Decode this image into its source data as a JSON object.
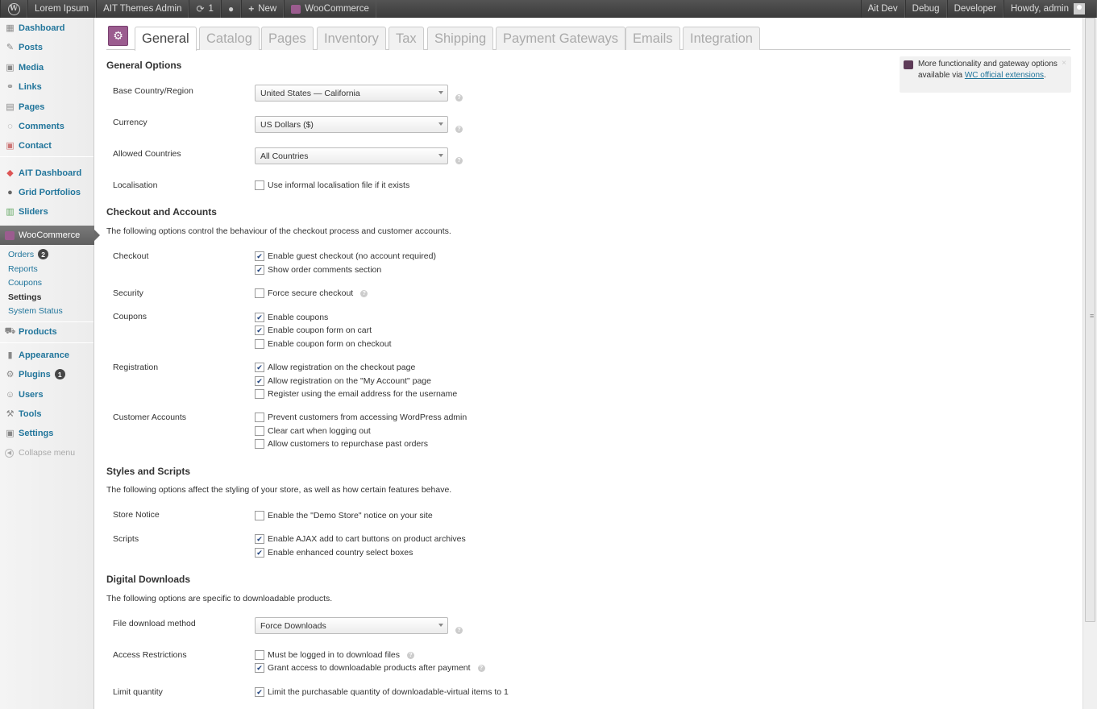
{
  "admin_bar": {
    "wp_logo": "W",
    "site_name": "Lorem Ipsum",
    "themes_admin": "AIT Themes Admin",
    "updates_count": "1",
    "new_label": "New",
    "woocommerce": "WooCommerce",
    "right": [
      "Ait Dev",
      "Debug",
      "Developer"
    ],
    "howdy": "Howdy, admin"
  },
  "sidebar": {
    "items": [
      {
        "label": "Dashboard",
        "icon": "dashboard-icon"
      },
      {
        "label": "Posts",
        "icon": "posts-icon"
      },
      {
        "label": "Media",
        "icon": "media-icon"
      },
      {
        "label": "Links",
        "icon": "links-icon"
      },
      {
        "label": "Pages",
        "icon": "pages-icon"
      },
      {
        "label": "Comments",
        "icon": "comments-icon"
      },
      {
        "label": "Contact",
        "icon": "contact-icon"
      },
      {
        "label": "AIT Dashboard",
        "icon": "ait-dashboard-icon"
      },
      {
        "label": "Grid Portfolios",
        "icon": "grid-portfolios-icon"
      },
      {
        "label": "Sliders",
        "icon": "sliders-icon"
      },
      {
        "label": "WooCommerce",
        "icon": "woocommerce-icon"
      },
      {
        "label": "Products",
        "icon": "products-icon"
      },
      {
        "label": "Appearance",
        "icon": "appearance-icon"
      },
      {
        "label": "Plugins",
        "icon": "plugins-icon",
        "badge": "1"
      },
      {
        "label": "Users",
        "icon": "users-icon"
      },
      {
        "label": "Tools",
        "icon": "tools-icon"
      },
      {
        "label": "Settings",
        "icon": "settings-icon"
      }
    ],
    "woo_submenu": [
      {
        "label": "Orders",
        "badge": "2"
      },
      {
        "label": "Reports"
      },
      {
        "label": "Coupons"
      },
      {
        "label": "Settings",
        "current": true
      },
      {
        "label": "System Status"
      }
    ],
    "collapse_label": "Collapse menu"
  },
  "tabs": [
    "General",
    "Catalog",
    "Pages",
    "Inventory",
    "Tax",
    "Shipping",
    "Payment Gateways",
    "Emails",
    "Integration"
  ],
  "active_tab": "General",
  "notice": {
    "text_before": "More functionality and gateway options available via ",
    "link": "WC official extensions",
    "text_after": ".",
    "close": "×"
  },
  "general_options": {
    "title": "General Options",
    "base_country_label": "Base Country/Region",
    "base_country_value": "United States — California",
    "currency_label": "Currency",
    "currency_value": "US Dollars ($)",
    "allowed_countries_label": "Allowed Countries",
    "allowed_countries_value": "All Countries",
    "localisation_label": "Localisation",
    "localisation_cb": "Use informal localisation file if it exists"
  },
  "checkout_accounts": {
    "title": "Checkout and Accounts",
    "desc": "The following options control the behaviour of the checkout process and customer accounts.",
    "checkout_label": "Checkout",
    "guest_checkout": "Enable guest checkout (no account required)",
    "order_comments": "Show order comments section",
    "security_label": "Security",
    "force_secure": "Force secure checkout",
    "coupons_label": "Coupons",
    "enable_coupons": "Enable coupons",
    "coupon_cart": "Enable coupon form on cart",
    "coupon_checkout": "Enable coupon form on checkout",
    "registration_label": "Registration",
    "reg_checkout": "Allow registration on the checkout page",
    "reg_myaccount": "Allow registration on the \"My Account\" page",
    "reg_email": "Register using the email address for the username",
    "customer_accounts_label": "Customer Accounts",
    "prevent_admin": "Prevent customers from accessing WordPress admin",
    "clear_cart": "Clear cart when logging out",
    "repurchase": "Allow customers to repurchase past orders"
  },
  "styles_scripts": {
    "title": "Styles and Scripts",
    "desc": "The following options affect the styling of your store, as well as how certain features behave.",
    "store_notice_label": "Store Notice",
    "demo_store": "Enable the \"Demo Store\" notice on your site",
    "scripts_label": "Scripts",
    "ajax_cart": "Enable AJAX add to cart buttons on product archives",
    "enhanced_select": "Enable enhanced country select boxes"
  },
  "digital_downloads": {
    "title": "Digital Downloads",
    "desc": "The following options are specific to downloadable products.",
    "method_label": "File download method",
    "method_value": "Force Downloads",
    "access_label": "Access Restrictions",
    "must_login": "Must be logged in to download files",
    "grant_access": "Grant access to downloadable products after payment",
    "limit_label": "Limit quantity",
    "limit_qty": "Limit the purchasable quantity of downloadable-virtual items to 1"
  },
  "checkbox_states": {
    "localisation": false,
    "guest_checkout": true,
    "order_comments": true,
    "force_secure": false,
    "enable_coupons": true,
    "coupon_cart": true,
    "coupon_checkout": false,
    "reg_checkout": true,
    "reg_myaccount": true,
    "reg_email": false,
    "prevent_admin": false,
    "clear_cart": false,
    "repurchase": false,
    "demo_store": false,
    "ajax_cart": true,
    "enhanced_select": true,
    "must_login": false,
    "grant_access": true,
    "limit_qty": true
  },
  "colors": {
    "link": "#21759b",
    "woo_purple": "#9b5c8f",
    "admin_bar": "#464646"
  }
}
